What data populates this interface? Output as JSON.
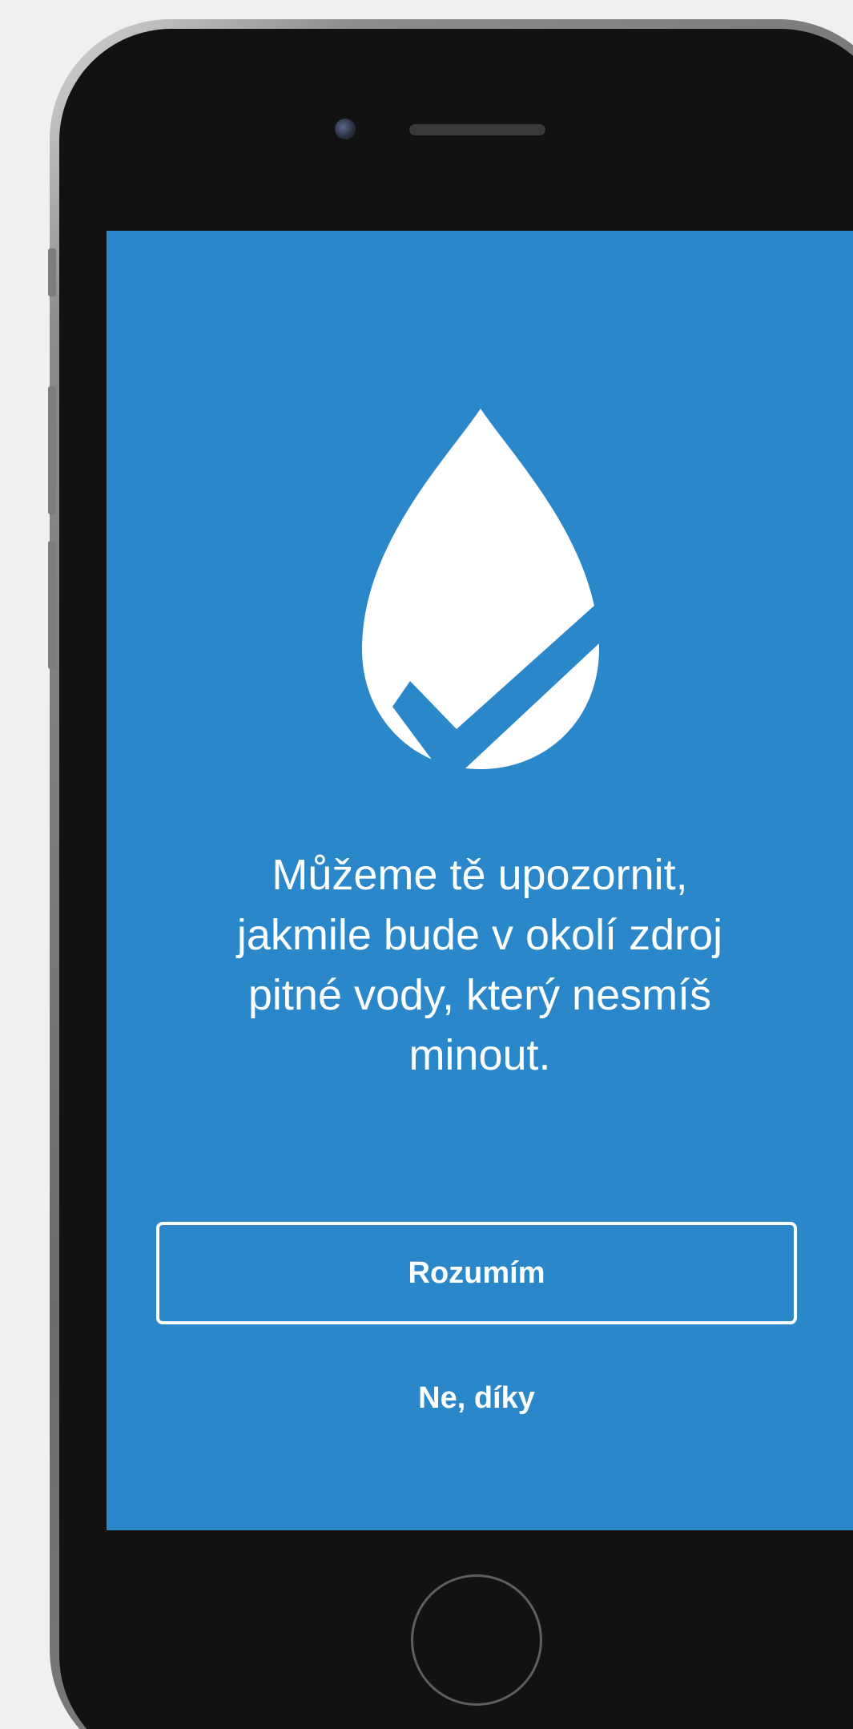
{
  "screen": {
    "background_color": "#2a87c9",
    "icon": "water-drop-check-icon",
    "message": "Můžeme tě upozornit,\njakmile bude v okolí zdroj\npitné vody, který nesmíš\nminout.",
    "primary_button_label": "Rozumím",
    "secondary_link_label": "Ne, díky"
  },
  "device": {
    "frame_color": "#121212",
    "accent_color": "#ffffff"
  }
}
